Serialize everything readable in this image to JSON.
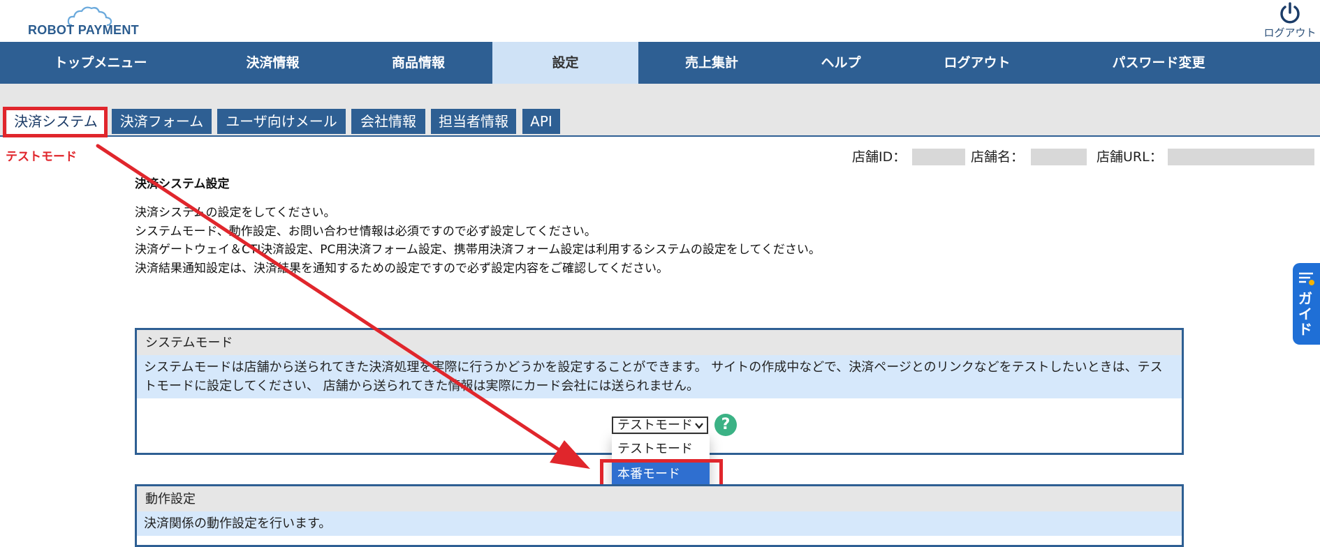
{
  "logo": {
    "text": "ROBOT PAYMENT"
  },
  "logout_icon": {
    "label": "ログアウト",
    "icon": "power-icon"
  },
  "nav": {
    "items": [
      {
        "label": "トップメニュー"
      },
      {
        "label": "決済情報"
      },
      {
        "label": "商品情報"
      },
      {
        "label": "設定"
      },
      {
        "label": "売上集計"
      },
      {
        "label": "ヘルプ"
      },
      {
        "label": "ログアウト"
      },
      {
        "label": "パスワード変更"
      }
    ],
    "active": "設定"
  },
  "tabs": {
    "items": [
      {
        "label": "決済システム"
      },
      {
        "label": "決済フォーム"
      },
      {
        "label": "ユーザ向けメール"
      },
      {
        "label": "会社情報"
      },
      {
        "label": "担当者情報"
      },
      {
        "label": "API"
      }
    ],
    "active": "決済システム"
  },
  "status": {
    "mode_label": "テストモード"
  },
  "shop_info": {
    "id_label": "店舗ID：",
    "name_label": "店舗名：",
    "url_label": "店舗URL："
  },
  "page": {
    "title": "決済システム設定",
    "description": [
      "決済システムの設定をしてください。",
      "システムモード、動作設定、お問い合わせ情報は必須ですので必ず設定してください。",
      "決済ゲートウェイ＆CTI決済設定、PC用決済フォーム設定、携帯用決済フォーム設定は利用するシステムの設定をしてください。",
      "決済結果通知設定は、決済結果を通知するための設定ですので必ず設定内容をご確認してください。"
    ]
  },
  "system_mode": {
    "heading": "システムモード",
    "text": "システムモードは店舗から送られてきた決済処理を実際に行うかどうかを設定することができます。 サイトの作成中などで、決済ページとのリンクなどをテストしたいときは、テストモードに設定してください、 店舗から送られてきた情報は実際にカード会社には送られません。",
    "select_value": "テストモード",
    "options": [
      {
        "label": "テストモード"
      },
      {
        "label": "本番モード"
      }
    ],
    "highlighted_option": "本番モード",
    "help_symbol": "?"
  },
  "operation": {
    "heading": "動作設定",
    "text": "決済関係の動作設定を行います。"
  },
  "guide": {
    "label": "ガイド",
    "icon": "list-icon"
  },
  "colors": {
    "nav_bg": "#2e5f93",
    "active_tab": "#cfe2f6",
    "annotation_red": "#e0262c",
    "guide_blue": "#1f6fd6",
    "help_green": "#3bb285"
  }
}
